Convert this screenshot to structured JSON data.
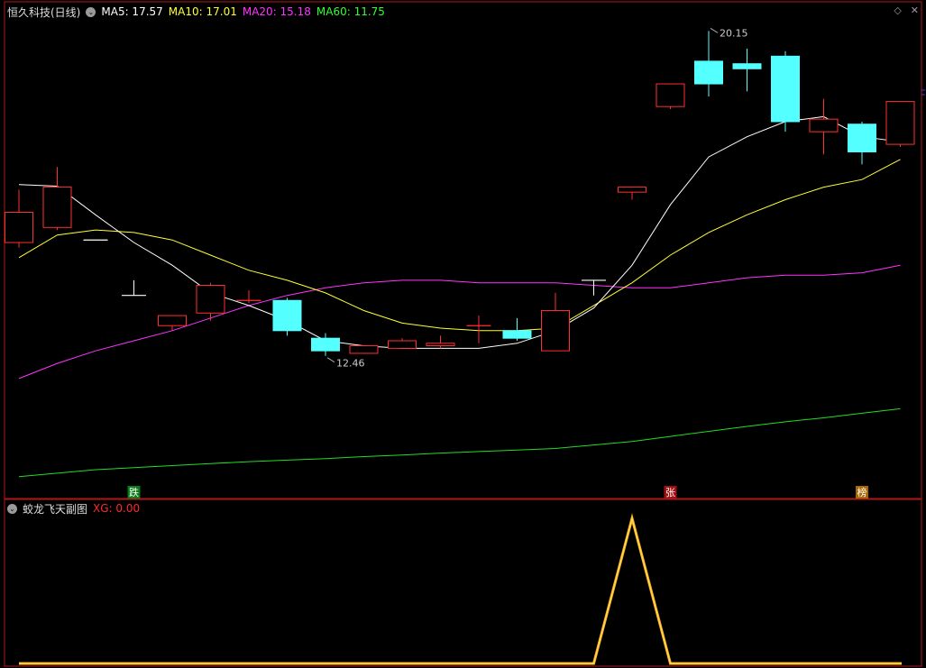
{
  "header": {
    "title": "恒久科技(日线)",
    "ma": [
      {
        "text": "MA5: 17.57",
        "color": "#ffffff"
      },
      {
        "text": "MA10: 17.01",
        "color": "#ffff33"
      },
      {
        "text": "MA20: 15.18",
        "color": "#ff33ff"
      },
      {
        "text": "MA60: 11.75",
        "color": "#33ff33"
      }
    ],
    "icons": [
      "diamond-icon",
      "close-icon"
    ]
  },
  "sub_header": {
    "title": "蛟龙飞天副图",
    "indicator": "XG: 0.00",
    "indicator_color": "#ff2a2a"
  },
  "colors": {
    "up": "#ff3030",
    "down": "#54ffff",
    "ma5": "#ffffff",
    "ma10": "#ffff33",
    "ma20": "#ff33ff",
    "ma60": "#22dd22",
    "frame": "#b01818",
    "xg": "#ffb020"
  },
  "annotations": {
    "high": "20.15",
    "low": "12.46"
  },
  "markers": [
    "跌",
    "张",
    "榜"
  ],
  "chart_data": {
    "type": "candlestick",
    "ylim": [
      11.1,
      20.3
    ],
    "candles": [
      {
        "o": 15.95,
        "c": 16.55,
        "h": 17.0,
        "l": 15.85
      },
      {
        "o": 16.25,
        "c": 17.05,
        "h": 17.45,
        "l": 16.2
      },
      {
        "o": 16.0,
        "c": 16.0,
        "h": 16.0,
        "l": 16.0
      },
      {
        "o": 14.9,
        "c": 14.9,
        "h": 15.2,
        "l": 14.9
      },
      {
        "o": 14.3,
        "c": 14.5,
        "h": 14.5,
        "l": 14.2
      },
      {
        "o": 14.55,
        "c": 15.1,
        "h": 15.15,
        "l": 14.4
      },
      {
        "o": 14.8,
        "c": 14.8,
        "h": 15.0,
        "l": 14.75
      },
      {
        "o": 14.8,
        "c": 14.2,
        "h": 14.85,
        "l": 14.1
      },
      {
        "o": 14.05,
        "c": 13.8,
        "h": 14.15,
        "l": 13.7
      },
      {
        "o": 13.75,
        "c": 13.9,
        "h": 13.9,
        "l": 13.75
      },
      {
        "o": 13.85,
        "c": 14.0,
        "h": 14.05,
        "l": 13.85
      },
      {
        "o": 13.9,
        "c": 13.95,
        "h": 14.1,
        "l": 13.85
      },
      {
        "o": 14.3,
        "c": 14.3,
        "h": 14.5,
        "l": 13.95
      },
      {
        "o": 14.2,
        "c": 14.05,
        "h": 14.45,
        "l": 14.0
      },
      {
        "o": 13.8,
        "c": 14.6,
        "h": 14.95,
        "l": 13.8
      },
      {
        "o": 15.2,
        "c": 15.2,
        "h": 15.2,
        "l": 14.9
      },
      {
        "o": 16.95,
        "c": 17.05,
        "h": 17.05,
        "l": 16.8
      },
      {
        "o": 18.65,
        "c": 19.1,
        "h": 19.1,
        "l": 18.6
      },
      {
        "o": 19.55,
        "c": 19.1,
        "h": 20.15,
        "l": 18.85
      },
      {
        "o": 19.5,
        "c": 19.4,
        "h": 19.8,
        "l": 18.95
      },
      {
        "o": 19.65,
        "c": 18.35,
        "h": 19.75,
        "l": 18.15
      },
      {
        "o": 18.15,
        "c": 18.4,
        "h": 18.8,
        "l": 17.7
      },
      {
        "o": 18.3,
        "c": 17.75,
        "h": 18.35,
        "l": 17.5
      },
      {
        "o": 17.9,
        "c": 18.75,
        "h": 18.75,
        "l": 17.85
      }
    ],
    "ma5": [
      17.1,
      17.07,
      16.5,
      15.95,
      15.5,
      14.95,
      14.7,
      14.4,
      14.0,
      13.9,
      13.85,
      13.85,
      13.85,
      13.95,
      14.2,
      14.65,
      15.5,
      16.7,
      17.65,
      18.05,
      18.35,
      18.45,
      18.05,
      17.95
    ],
    "ma10": [
      15.65,
      16.1,
      16.2,
      16.15,
      16.0,
      15.7,
      15.4,
      15.2,
      14.95,
      14.6,
      14.35,
      14.25,
      14.2,
      14.2,
      14.25,
      14.7,
      15.15,
      15.7,
      16.15,
      16.5,
      16.8,
      17.05,
      17.2,
      17.6
    ],
    "ma20": [
      13.25,
      13.55,
      13.8,
      14.0,
      14.2,
      14.45,
      14.7,
      14.9,
      15.05,
      15.15,
      15.2,
      15.2,
      15.15,
      15.15,
      15.15,
      15.1,
      15.05,
      15.05,
      15.15,
      15.25,
      15.3,
      15.3,
      15.35,
      15.5
    ],
    "ma60": [
      11.3,
      11.37,
      11.44,
      11.48,
      11.52,
      11.56,
      11.6,
      11.63,
      11.66,
      11.7,
      11.73,
      11.77,
      11.8,
      11.83,
      11.86,
      11.93,
      12.0,
      12.1,
      12.2,
      12.3,
      12.39,
      12.47,
      12.56,
      12.65
    ],
    "xg": [
      0,
      0,
      0,
      0,
      0,
      0,
      0,
      0,
      0,
      0,
      0,
      0,
      0,
      0,
      0,
      0,
      1,
      0,
      0,
      0,
      0,
      0,
      0,
      0
    ]
  }
}
